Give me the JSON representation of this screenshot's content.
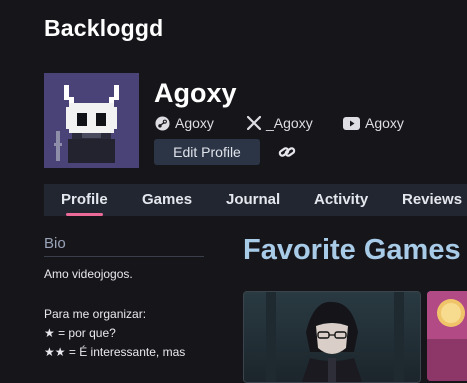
{
  "site": {
    "name": "Backloggd"
  },
  "profile": {
    "username": "Agoxy",
    "socials": [
      {
        "platform": "steam",
        "icon": "steam-icon",
        "handle": "Agoxy"
      },
      {
        "platform": "x",
        "icon": "x-icon",
        "handle": "_Agoxy"
      },
      {
        "platform": "youtube",
        "icon": "youtube-icon",
        "handle": "Agoxy"
      }
    ],
    "edit_label": "Edit Profile",
    "link_icon": "link-icon"
  },
  "nav": {
    "items": [
      "Profile",
      "Games",
      "Journal",
      "Activity",
      "Reviews"
    ],
    "active": "Profile",
    "accent": "#ec6a98"
  },
  "bio": {
    "title": "Bio",
    "lines": [
      "Amo videojogos.",
      "Para me organizar:",
      "★ = por que?",
      "★★ = É interessante, mas"
    ]
  },
  "favorites": {
    "title": "Favorite Games"
  },
  "colors": {
    "background": "#16161a",
    "nav_bg": "#222630",
    "button_bg": "#2c3546",
    "heading_blue": "#a8cbe8"
  }
}
